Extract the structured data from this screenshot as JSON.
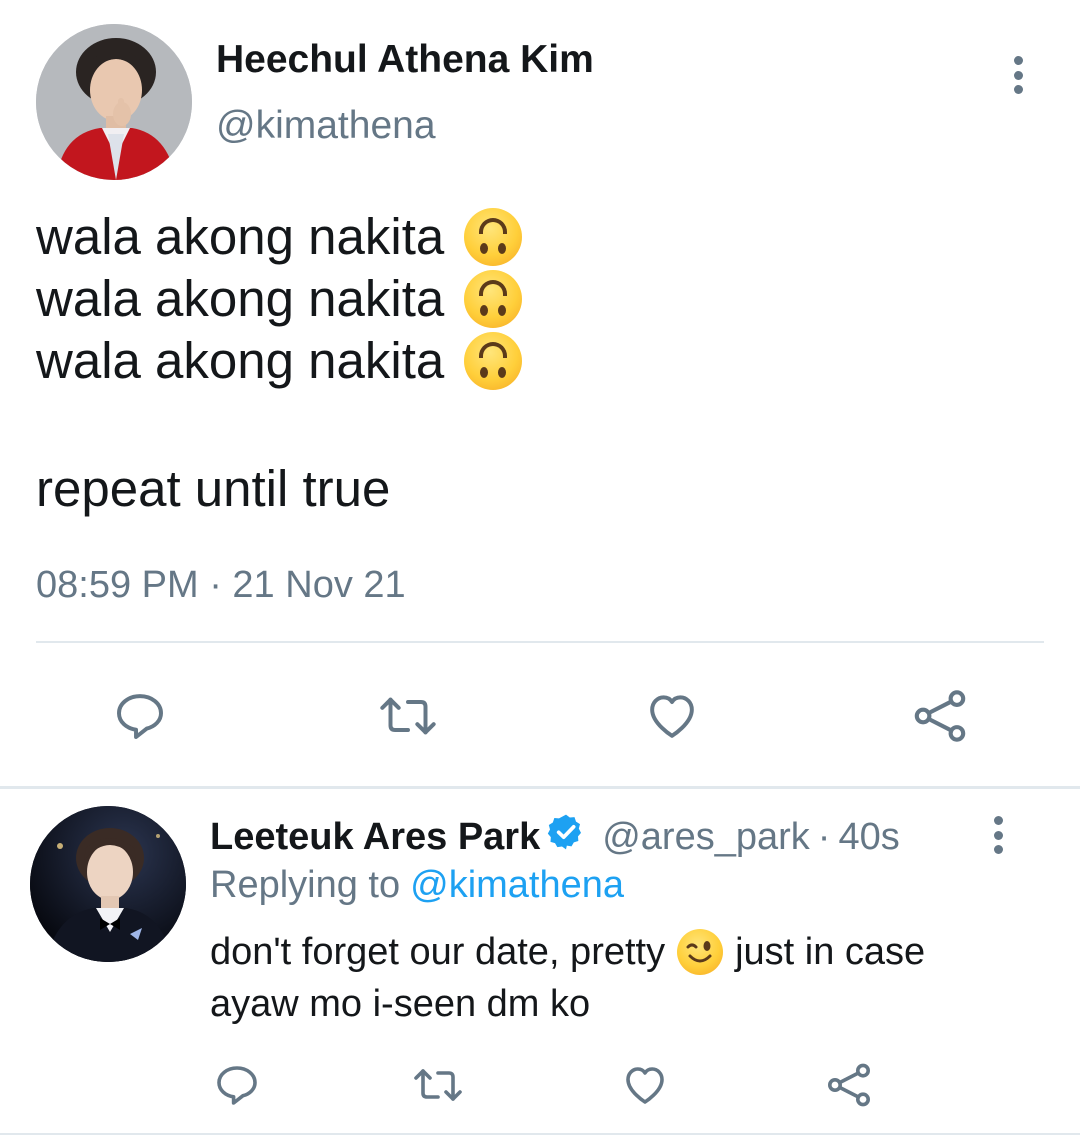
{
  "tweet": {
    "author_name": "Heechul Athena Kim",
    "author_handle": "@kimathena",
    "lines": [
      "wala akong nakita",
      "wala akong nakita",
      "wala akong nakita"
    ],
    "line_emoji": "upside-down-face-emoji",
    "closing_line": "repeat until true",
    "timestamp": "08:59 PM · 21 Nov 21",
    "actions": [
      "reply-icon",
      "retweet-icon",
      "like-icon",
      "share-icon"
    ],
    "menu_icon": "more-vertical-icon"
  },
  "reply": {
    "author_name": "Leeteuk Ares Park",
    "verified": true,
    "author_handle": "@ares_park",
    "separator": "·",
    "time_ago": "40s",
    "replying_prefix": "Replying to",
    "replying_to": "@kimathena",
    "text_part1": "don't forget our date, pretty",
    "text_emoji": "winking-face-emoji",
    "text_part2": "just in case",
    "text_line2": "ayaw mo i-seen dm ko",
    "actions": [
      "reply-icon",
      "retweet-icon",
      "like-icon",
      "share-icon"
    ],
    "menu_icon": "more-vertical-icon"
  },
  "colors": {
    "text": "#14171a",
    "secondary": "#657786",
    "link": "#1da1f2",
    "divider": "#e1e8ed",
    "emoji": "#ffcf3a"
  }
}
